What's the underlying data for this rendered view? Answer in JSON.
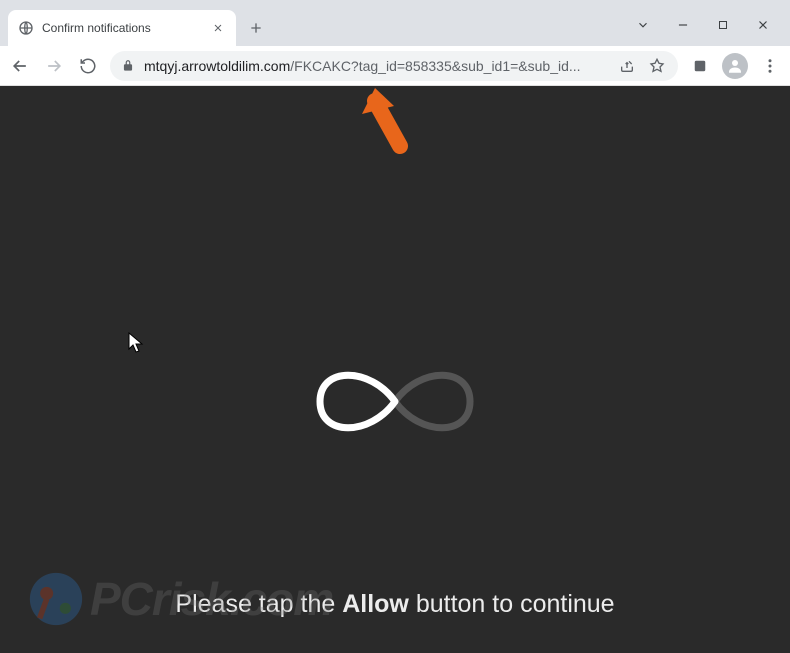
{
  "tab": {
    "title": "Confirm notifications"
  },
  "url": {
    "host": "mtqyj.arrowtoldilim.com",
    "path": "/FKCAKC?tag_id=858335&sub_id1=&sub_id...",
    "full": "mtqyj.arrowtoldilim.com/FKCAKC?tag_id=858335&sub_id1=&sub_id..."
  },
  "page": {
    "prompt_pre": "Please tap the ",
    "prompt_bold": "Allow",
    "prompt_post": " button to continue"
  },
  "watermark": {
    "text": "PCrisk.com"
  }
}
